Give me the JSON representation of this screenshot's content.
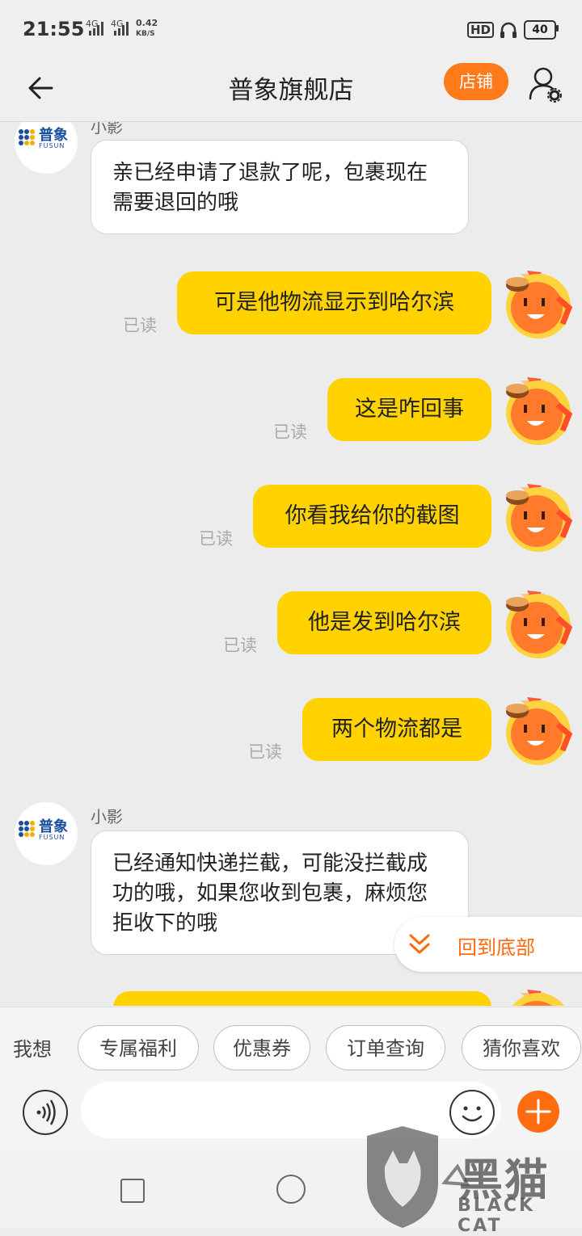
{
  "status_bar": {
    "time": "21:55",
    "network_1": "4G",
    "network_2": "4G",
    "speed_value": "0.42",
    "speed_unit": "KB/S",
    "hd": "HD",
    "battery": "40"
  },
  "header": {
    "title": "普象旗舰店",
    "shop_label": "店铺"
  },
  "messages": [
    {
      "from": "shop",
      "sender": "小影",
      "text": "亲已经申请了退款了呢，包裹现在需要退回的哦"
    },
    {
      "from": "me",
      "text": "可是他物流显示到哈尔滨",
      "read": "已读"
    },
    {
      "from": "me",
      "text": "这是咋回事",
      "read": "已读"
    },
    {
      "from": "me",
      "text": "你看我给你的截图",
      "read": "已读"
    },
    {
      "from": "me",
      "text": "他是发到哈尔滨",
      "read": "已读"
    },
    {
      "from": "me",
      "text": "两个物流都是",
      "read": "已读"
    },
    {
      "from": "shop",
      "sender": "小影",
      "text": "已经通知快递拦截，可能没拦截成功的哦，如果您收到包裹，麻烦您拒收下的哦"
    }
  ],
  "shop_logo": {
    "cn": "普象",
    "en": "FUSUN"
  },
  "scroll_bottom_label": "回到底部",
  "quick_bar": {
    "prefix": "我想",
    "chips": [
      "专属福利",
      "优惠券",
      "订单查询",
      "猜你喜欢"
    ]
  },
  "watermark": {
    "cn": "黑猫",
    "en": "BLACK CAT"
  },
  "colors": {
    "accent": "#ff7a1a",
    "bubble_out": "#ffd200",
    "background": "#ececec"
  }
}
